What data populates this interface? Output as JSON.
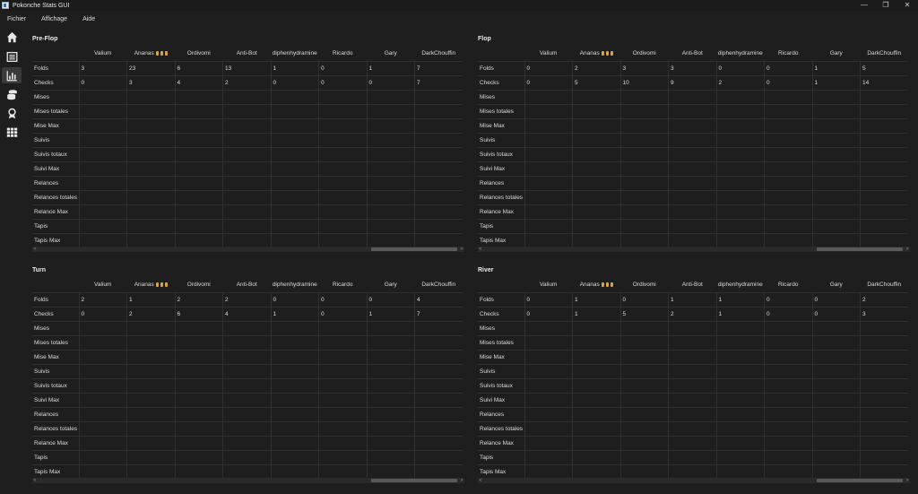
{
  "window": {
    "title": "Pokonche Stats GUI",
    "minimize": "—",
    "maximize": "❐",
    "close": "✕"
  },
  "menu": [
    "Fichier",
    "Affichage",
    "Aide"
  ],
  "toolbar": [
    "home-icon",
    "list-icon",
    "chart-icon",
    "coins-icon",
    "award-icon",
    "grid-icon"
  ],
  "columns": [
    "",
    "Valium",
    "Ananas",
    "Ordivomi",
    "Anti-Bot",
    "diphenhydramine",
    "Ricardo",
    "Gary",
    "DarkChouffin"
  ],
  "row_labels": [
    "Folds",
    "Checks",
    "Mises",
    "Mises totales",
    "Mise Max",
    "Suivis",
    "Suivis totaux",
    "Suivi Max",
    "Relances",
    "Relances totales",
    "Relance Max",
    "Tapis",
    "Tapis Max"
  ],
  "panels": [
    {
      "title": "Pre-Flop",
      "rows": [
        [
          "3",
          "23",
          "6",
          "13",
          "1",
          "0",
          "1",
          "7"
        ],
        [
          "0",
          "3",
          "4",
          "2",
          "0",
          "0",
          "0",
          "7"
        ]
      ]
    },
    {
      "title": "Flop",
      "rows": [
        [
          "0",
          "2",
          "3",
          "3",
          "0",
          "0",
          "1",
          "5"
        ],
        [
          "0",
          "5",
          "10",
          "9",
          "2",
          "0",
          "1",
          "14"
        ]
      ]
    },
    {
      "title": "Turn",
      "rows": [
        [
          "2",
          "1",
          "2",
          "2",
          "0",
          "0",
          "0",
          "4"
        ],
        [
          "0",
          "2",
          "6",
          "4",
          "1",
          "0",
          "1",
          "7"
        ]
      ]
    },
    {
      "title": "River",
      "rows": [
        [
          "0",
          "1",
          "0",
          "1",
          "1",
          "0",
          "0",
          "2"
        ],
        [
          "0",
          "1",
          "5",
          "2",
          "1",
          "0",
          "0",
          "3"
        ]
      ]
    }
  ],
  "scroll": {
    "left": "<",
    "right": ">"
  }
}
